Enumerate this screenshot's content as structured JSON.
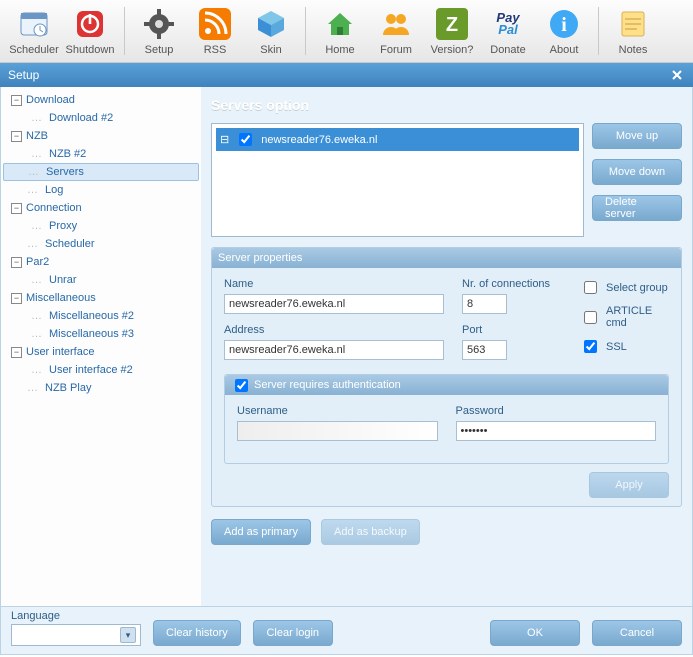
{
  "toolbar": {
    "scheduler": "Scheduler",
    "shutdown": "Shutdown",
    "setup": "Setup",
    "rss": "RSS",
    "skin": "Skin",
    "home": "Home",
    "forum": "Forum",
    "version": "Version?",
    "donate": "Donate",
    "about": "About",
    "notes": "Notes",
    "donate_brand_top": "Pay",
    "donate_brand_bot": "Pal"
  },
  "window": {
    "title": "Setup"
  },
  "tree": {
    "download": "Download",
    "download2": "Download #2",
    "nzb": "NZB",
    "nzb2": "NZB #2",
    "servers": "Servers",
    "log": "Log",
    "connection": "Connection",
    "proxy": "Proxy",
    "scheduler": "Scheduler",
    "par2": "Par2",
    "unrar": "Unrar",
    "misc": "Miscellaneous",
    "misc2": "Miscellaneous #2",
    "misc3": "Miscellaneous #3",
    "ui": "User interface",
    "ui2": "User interface #2",
    "nzbplay": "NZB Play"
  },
  "page": {
    "title": "Servers option",
    "server_listed": "newsreader76.eweka.nl",
    "server_listed_checked": true,
    "move_up": "Move up",
    "move_down": "Move down",
    "delete": "Delete server"
  },
  "props": {
    "group_title": "Server properties",
    "name_label": "Name",
    "name_value": "newsreader76.eweka.nl",
    "address_label": "Address",
    "address_value": "newsreader76.eweka.nl",
    "connections_label": "Nr. of connections",
    "connections_value": "8",
    "port_label": "Port",
    "port_value": "563",
    "select_group_label": "Select group",
    "select_group_checked": false,
    "article_cmd_label": "ARTICLE cmd",
    "article_cmd_checked": false,
    "ssl_label": "SSL",
    "ssl_checked": true
  },
  "auth": {
    "header": "Server requires authentication",
    "header_checked": true,
    "user_label": "Username",
    "user_value": "",
    "pass_label": "Password",
    "pass_value": "•••••••"
  },
  "buttons": {
    "apply": "Apply",
    "add_primary": "Add as primary",
    "add_backup": "Add as backup"
  },
  "footer": {
    "language_label": "Language",
    "clear_history": "Clear history",
    "clear_login": "Clear login",
    "ok": "OK",
    "cancel": "Cancel"
  }
}
